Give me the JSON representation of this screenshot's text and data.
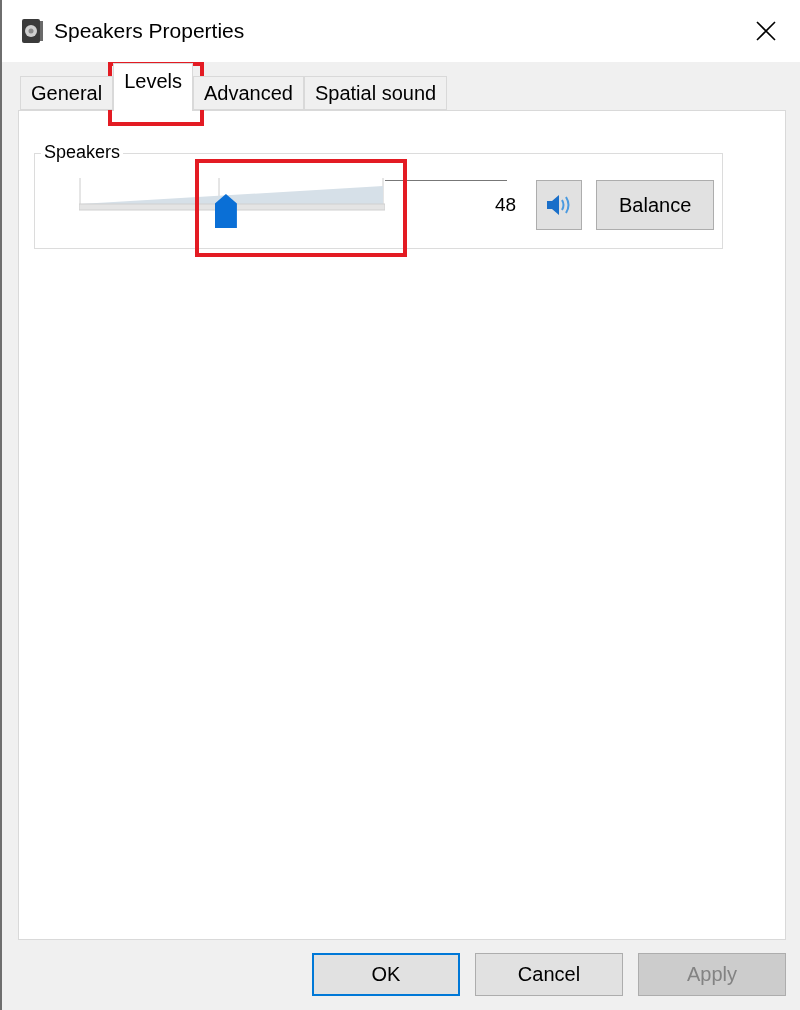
{
  "window": {
    "title": "Speakers Properties"
  },
  "tabs": [
    {
      "label": "General",
      "selected": false
    },
    {
      "label": "Levels",
      "selected": true
    },
    {
      "label": "Advanced",
      "selected": false
    },
    {
      "label": "Spatial sound",
      "selected": false
    }
  ],
  "levels": [
    {
      "name": "Speakers",
      "level": 0.48,
      "reading": "48",
      "muted": false,
      "balance_button": "Balance"
    }
  ],
  "buttons": [
    {
      "label": "OK",
      "kind": "default",
      "disabled": false
    },
    {
      "label": "Cancel",
      "kind": "normal",
      "disabled": false
    },
    {
      "label": "Apply",
      "kind": "normal",
      "disabled": true
    }
  ]
}
